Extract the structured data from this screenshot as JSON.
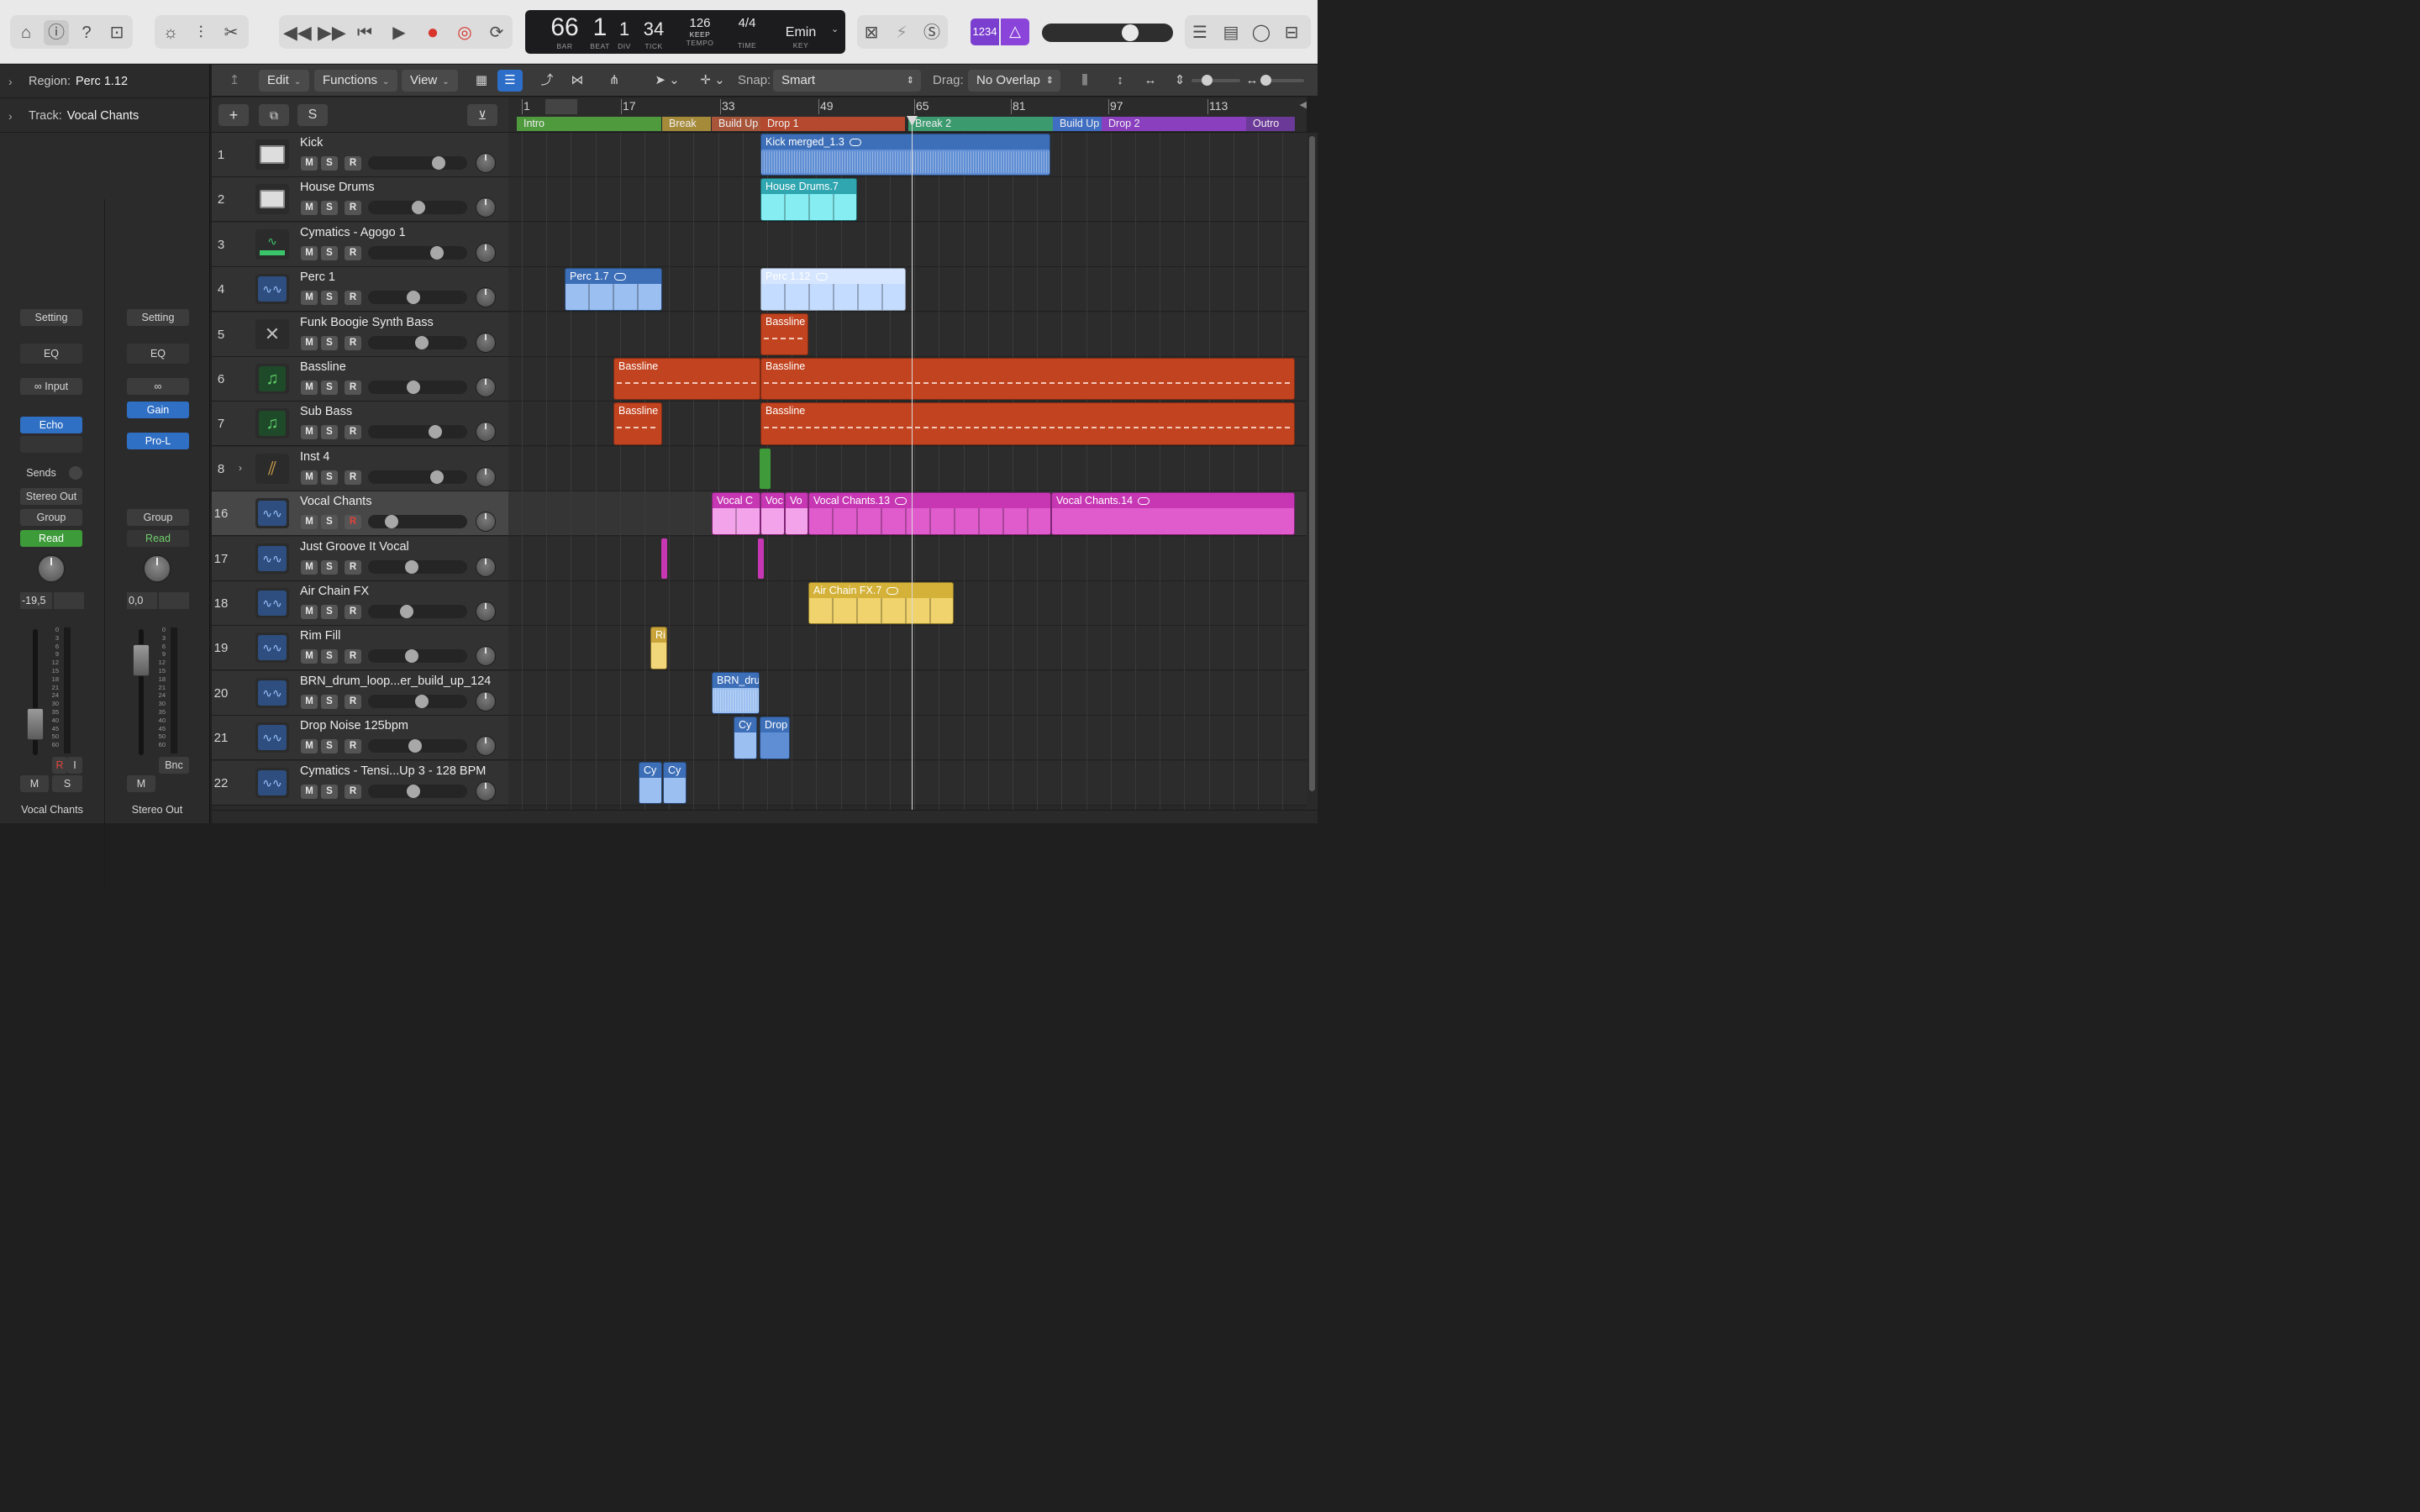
{
  "transport": {
    "bar": "66",
    "beat": "1",
    "div": "1",
    "tick": "34",
    "tempo": "126",
    "tempo_mode": "KEEP",
    "time_sig_top": "4",
    "time_sig_bottom": "4",
    "key": "Emin",
    "labels": {
      "bar": "BAR",
      "beat": "BEAT",
      "div": "DIV",
      "tick": "TICK",
      "tempo": "TEMPO",
      "time": "TIME",
      "key": "KEY"
    },
    "counter_badge": "1234"
  },
  "inspector": {
    "region_label": "Region:",
    "region_value": "Perc 1.12",
    "track_label": "Track:",
    "track_value": "Vocal Chants"
  },
  "strips": [
    {
      "setting": "Setting",
      "eq": "EQ",
      "input": "Input",
      "plugin": "Echo",
      "sends": "Sends",
      "output": "Stereo Out",
      "group": "Group",
      "automation": "Read",
      "value": "-19,5",
      "rec": "R",
      "input_mon": "I",
      "mute": "M",
      "solo": "S",
      "name": "Vocal Chants"
    },
    {
      "setting": "Setting",
      "eq": "EQ",
      "plugin1": "Gain",
      "plugin2": "Pro-L",
      "group": "Group",
      "automation": "Read",
      "value": "0,0",
      "bounce": "Bnc",
      "mute": "M",
      "name": "Stereo Out"
    }
  ],
  "meter_scale": [
    "0",
    "3",
    "6",
    "9",
    "12",
    "15",
    "18",
    "21",
    "24",
    "30",
    "35",
    "40",
    "45",
    "50",
    "60"
  ],
  "toolbar": {
    "edit": "Edit",
    "functions": "Functions",
    "view": "View",
    "snap_label": "Snap:",
    "snap_value": "Smart",
    "drag_label": "Drag:",
    "drag_value": "No Overlap"
  },
  "header_tools": {
    "solo_btn": "S"
  },
  "ruler": {
    "bars": [
      "1",
      "17",
      "33",
      "49",
      "65",
      "81",
      "97",
      "113"
    ],
    "markers": [
      {
        "name": "Intro",
        "color": "#4f9a3d"
      },
      {
        "name": "Break",
        "color": "#a58a3a"
      },
      {
        "name": "Build Up",
        "color": "#a8553a"
      },
      {
        "name": "Drop 1",
        "color": "#b5492f"
      },
      {
        "name": "Break 2",
        "color": "#3c9a6f"
      },
      {
        "name": "Build Up",
        "color": "#3f6ec2"
      },
      {
        "name": "Drop 2",
        "color": "#8a3fbf"
      },
      {
        "name": "Outro",
        "color": "#6b3a98"
      }
    ]
  },
  "tracks": [
    {
      "num": "1",
      "name": "Kick",
      "icon": "drum-machine-icon"
    },
    {
      "num": "2",
      "name": "House Drums",
      "icon": "drum-machine-icon"
    },
    {
      "num": "3",
      "name": "Cymatics - Agogo 1",
      "icon": "keyboard-synth-icon"
    },
    {
      "num": "4",
      "name": "Perc 1",
      "icon": "waveform-icon"
    },
    {
      "num": "5",
      "name": "Funk Boogie Synth Bass",
      "icon": "synth-stand-icon"
    },
    {
      "num": "6",
      "name": "Bassline",
      "icon": "music-note-icon"
    },
    {
      "num": "7",
      "name": "Sub Bass",
      "icon": "music-note-icon"
    },
    {
      "num": "8",
      "name": "Inst 4",
      "icon": "track-stack-icon"
    },
    {
      "num": "16",
      "name": "Vocal Chants",
      "icon": "waveform-icon"
    },
    {
      "num": "17",
      "name": "Just Groove It Vocal",
      "icon": "waveform-icon"
    },
    {
      "num": "18",
      "name": "Air Chain FX",
      "icon": "waveform-icon"
    },
    {
      "num": "19",
      "name": "Rim Fill",
      "icon": "waveform-icon"
    },
    {
      "num": "20",
      "name": "BRN_drum_loop...er_build_up_124",
      "icon": "waveform-icon"
    },
    {
      "num": "21",
      "name": "Drop Noise 125bpm",
      "icon": "waveform-icon"
    },
    {
      "num": "22",
      "name": "Cymatics - Tensi...Up 3 - 128 BPM",
      "icon": "waveform-icon"
    }
  ],
  "msr": {
    "mute": "M",
    "solo": "S",
    "rec": "R"
  },
  "regions": {
    "kick": "Kick merged_1.3",
    "house": "House Drums.7",
    "perc_a": "Perc 1.7",
    "perc_b": "Perc 1.12",
    "bass5": "Bassline",
    "bass6a": "Bassline",
    "bass6b": "Bassline",
    "bass7a": "Bassline",
    "bass7b": "Bassline",
    "vocal_a": "Vocal C",
    "vocal_b": "Voc",
    "vocal_c": "Vo",
    "vocal_d": "Vocal Chants.13",
    "vocal_e": "Vocal Chants.14",
    "airchain": "Air Chain FX.7",
    "rim": "Ri",
    "brn": "BRN_dru",
    "cy21": "Cy",
    "drop21": "Drop",
    "cy22a": "Cy",
    "cy22b": "Cy"
  },
  "colors": {
    "audio_blue": "#3d6fb8",
    "cyan": "#3fbcc4",
    "bass_orange": "#c2431f",
    "vocal_pink": "#c737b4",
    "air_yellow": "#d4b23a",
    "inst_green": "#3f9a3a"
  }
}
